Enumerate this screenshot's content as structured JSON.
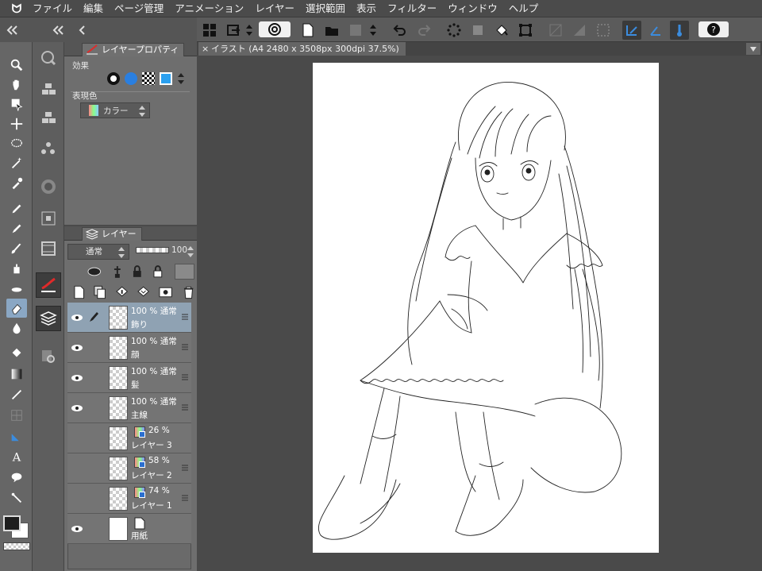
{
  "app": {
    "logo": "ᗢ",
    "menu": [
      "ファイル",
      "編集",
      "ページ管理",
      "アニメーション",
      "レイヤー",
      "選択範囲",
      "表示",
      "フィルター",
      "ウィンドウ",
      "ヘルプ"
    ]
  },
  "panels": {
    "property_tab": "レイヤープロパティ",
    "effect_label": "効果",
    "expression_label": "表現色",
    "expression_value": "カラー",
    "layer_tab": "レイヤー",
    "blend_mode": "通常",
    "opacity": "100"
  },
  "canvas": {
    "tab_title": "イラスト (A4 2480 x 3508px 300dpi 37.5%)",
    "close_glyph": "×"
  },
  "layers": [
    {
      "mode": "100 % 通常",
      "name": "飾り",
      "visible": true,
      "editing": true,
      "selected": true,
      "type": "raster"
    },
    {
      "mode": "100 % 通常",
      "name": "顔",
      "visible": true,
      "editing": false,
      "selected": false,
      "type": "raster"
    },
    {
      "mode": "100 % 通常",
      "name": "髪",
      "visible": true,
      "editing": false,
      "selected": false,
      "type": "raster"
    },
    {
      "mode": "100 % 通常",
      "name": "主線",
      "visible": true,
      "editing": false,
      "selected": false,
      "type": "raster"
    },
    {
      "mode": "26 % ",
      "name": "レイヤー 3",
      "visible": false,
      "editing": false,
      "selected": false,
      "type": "color"
    },
    {
      "mode": "58 % ",
      "name": "レイヤー 2",
      "visible": false,
      "editing": false,
      "selected": false,
      "type": "color"
    },
    {
      "mode": "74 % ",
      "name": "レイヤー 1",
      "visible": false,
      "editing": false,
      "selected": false,
      "type": "color"
    },
    {
      "mode": "",
      "name": "用紙",
      "visible": true,
      "editing": false,
      "selected": false,
      "type": "paper"
    }
  ],
  "colors": {
    "main_color": "#1e1e1e",
    "sub_color": "#ffffff",
    "accent_select": "#8fa2b3",
    "tool_select": "#8aa7c4"
  }
}
